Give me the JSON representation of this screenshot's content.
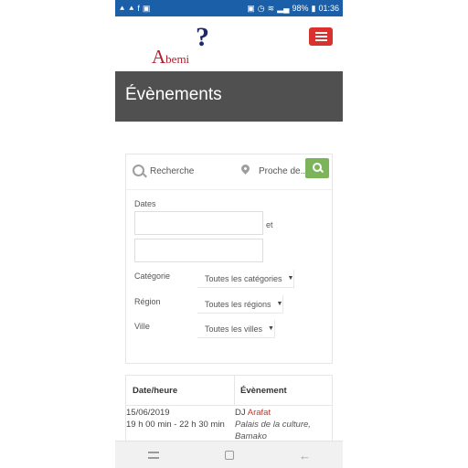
{
  "status_bar": {
    "battery": "98%",
    "time": "01:36",
    "left_icons": [
      "navigation-icon",
      "navigation-icon",
      "facebook-icon",
      "image-icon"
    ],
    "right_icons": [
      "gallery-icon",
      "alarm-icon",
      "wifi-icon",
      "signal-icon",
      "signal-icon",
      "battery-icon"
    ]
  },
  "header": {
    "logo_text_a": "A",
    "logo_text_rest": "bemi",
    "logo_qmark": "?"
  },
  "page": {
    "title": "Évènements"
  },
  "search": {
    "query_placeholder": "Recherche",
    "near_placeholder": "Proche de..."
  },
  "filters": {
    "dates_label": "Dates",
    "et_label": "et",
    "category_label": "Catégorie",
    "category_value": "Toutes les catégories",
    "region_label": "Région",
    "region_value": "Toutes les régions",
    "city_label": "Ville",
    "city_value": "Toutes les villes"
  },
  "table": {
    "headers": [
      "Date/heure",
      "Évènement"
    ],
    "rows": [
      {
        "date": "15/06/2019",
        "time": "19 h 00 min - 22 h 30 min",
        "dj_prefix": "DJ",
        "artist": "Arafat",
        "place_line1": "Palais de la culture,",
        "place_line2": "Bamako"
      }
    ]
  },
  "colors": {
    "status_bar": "#1a5fa8",
    "banner": "#505050",
    "menu_button": "#d9312e",
    "search_button": "#7cb45a",
    "link": "#c0392b"
  }
}
